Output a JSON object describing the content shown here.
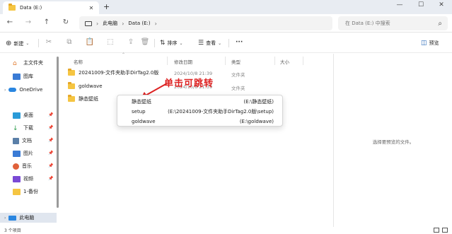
{
  "tab": {
    "title": "Data (E:)",
    "close": "✕",
    "new": "+"
  },
  "window": {
    "minimize": "—",
    "maximize": "☐",
    "close": "✕"
  },
  "nav": {
    "back": "←",
    "forward": "→",
    "up": "↑",
    "refresh": "↻"
  },
  "breadcrumb": {
    "sep": "›",
    "items": [
      "此电脑",
      "Data (E:)"
    ]
  },
  "search": {
    "placeholder": "在 Data (E:) 中搜索",
    "icon": "⌕"
  },
  "toolbar": {
    "new_label": "新建",
    "sort_label": "排序",
    "view_label": "查看",
    "more_label": "···",
    "preview_label": "预览",
    "icons": [
      "cut-icon",
      "copy-icon",
      "paste-icon",
      "rename-icon",
      "share-icon",
      "delete-icon"
    ]
  },
  "sidebar": {
    "items": [
      {
        "label": "主文件夹",
        "icon": "home-icon"
      },
      {
        "label": "图库",
        "icon": "gallery-icon"
      },
      {
        "label": "OneDrive",
        "icon": "cloud-icon"
      },
      {
        "label": "桌面",
        "icon": "desktop-icon"
      },
      {
        "label": "下载",
        "icon": "download-icon"
      },
      {
        "label": "文档",
        "icon": "document-icon"
      },
      {
        "label": "图片",
        "icon": "picture-icon"
      },
      {
        "label": "音乐",
        "icon": "music-icon"
      },
      {
        "label": "视频",
        "icon": "video-icon"
      },
      {
        "label": "1-备份",
        "icon": "folder-icon"
      },
      {
        "label": "此电脑",
        "icon": "pc-icon"
      }
    ],
    "pin": "📌"
  },
  "columns": {
    "name": "名称",
    "modified": "修改日期",
    "type": "类型",
    "size": "大小"
  },
  "rows": [
    {
      "name": "20241009-文件夹助手DirTag2.0版",
      "modified": "2024/10/8 21:39",
      "type": "文件夹"
    },
    {
      "name": "goldwave",
      "modified": "2024/10/8 21:39",
      "type": "文件夹"
    },
    {
      "name": "静态壁纸",
      "modified": "",
      "type": ""
    }
  ],
  "context_menu": [
    {
      "label": "静态壁纸",
      "path": "(E:\\静态壁纸)"
    },
    {
      "label": "setup",
      "path": "(E:\\20241009-文件夹助手DirTag2.0版\\setup)"
    },
    {
      "label": "goldwave",
      "path": "(E:\\goldwave)"
    }
  ],
  "annotation": "单击可跳转",
  "preview_pane": {
    "message": "选择要预览的文件。"
  },
  "status": {
    "count": "3 个项目"
  },
  "colors": {
    "annotation": "#dd2222",
    "folder": "#f5c542",
    "selection": "#e0e6ef"
  }
}
